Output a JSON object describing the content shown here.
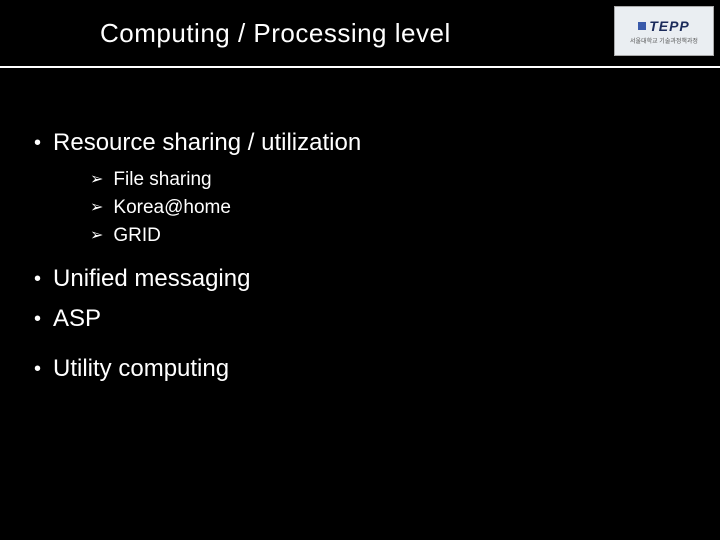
{
  "header": {
    "title": "Computing / Processing level",
    "logo": {
      "text_main": "TEPP",
      "text_sub": "서울대학교 기술과정책과정"
    }
  },
  "content": {
    "bullets": [
      {
        "text": "Resource sharing / utilization",
        "sub": [
          "File sharing",
          "Korea@home",
          "GRID"
        ]
      },
      {
        "text": "Unified messaging"
      },
      {
        "text": "ASP"
      },
      {
        "text": "Utility computing"
      }
    ]
  },
  "glyphs": {
    "bullet": "•",
    "arrow": "➢"
  }
}
